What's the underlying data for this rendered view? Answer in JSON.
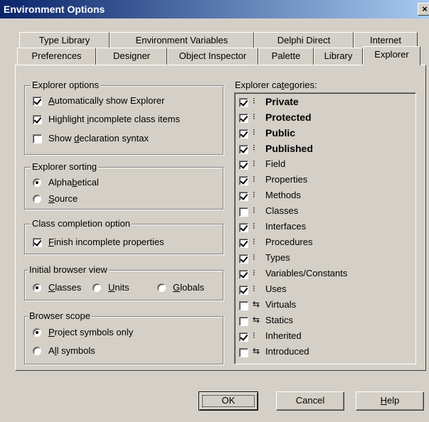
{
  "window": {
    "title": "Environment Options",
    "close_glyph": "×"
  },
  "tabs_row1": [
    {
      "label": "Type Library"
    },
    {
      "label": "Environment Variables"
    },
    {
      "label": "Delphi Direct"
    },
    {
      "label": "Internet"
    }
  ],
  "tabs_row2": [
    {
      "label": "Preferences"
    },
    {
      "label": "Designer"
    },
    {
      "label": "Object Inspector"
    },
    {
      "label": "Palette"
    },
    {
      "label": "Library"
    },
    {
      "label": "Explorer"
    }
  ],
  "active_tab": "Explorer",
  "explorer_options": {
    "legend": "Explorer options",
    "items": [
      {
        "pre": "",
        "acc": "A",
        "post": "utomatically show Explorer",
        "checked": true
      },
      {
        "pre": "Highlight ",
        "acc": "i",
        "post": "ncomplete class items",
        "checked": true
      },
      {
        "pre": "Show ",
        "acc": "d",
        "post": "eclaration syntax",
        "checked": false
      }
    ]
  },
  "explorer_sorting": {
    "legend": "Explorer sorting",
    "items": [
      {
        "pre": "Alpha",
        "acc": "b",
        "post": "etical",
        "checked": true
      },
      {
        "pre": "",
        "acc": "S",
        "post": "ource",
        "checked": false
      }
    ]
  },
  "class_completion": {
    "legend": "Class completion option",
    "items": [
      {
        "pre": "",
        "acc": "F",
        "post": "inish incomplete properties",
        "checked": true
      }
    ]
  },
  "initial_view": {
    "legend": "Initial browser view",
    "items": [
      {
        "pre": "",
        "acc": "C",
        "post": "lasses",
        "checked": true
      },
      {
        "pre": "",
        "acc": "U",
        "post": "nits",
        "checked": false
      },
      {
        "pre": "",
        "acc": "G",
        "post": "lobals",
        "checked": false
      }
    ]
  },
  "browser_scope": {
    "legend": "Browser scope",
    "items": [
      {
        "pre": "",
        "acc": "P",
        "post": "roject symbols only",
        "checked": true
      },
      {
        "pre": "A",
        "acc": "l",
        "post": "l symbols",
        "checked": false
      }
    ]
  },
  "categories": {
    "label_pre": "Explorer ca",
    "label_acc": "t",
    "label_post": "egories:",
    "items": [
      {
        "label": "Private",
        "checked": true,
        "bold": true,
        "icon": "⁝"
      },
      {
        "label": "Protected",
        "checked": true,
        "bold": true,
        "icon": "⁝"
      },
      {
        "label": "Public",
        "checked": true,
        "bold": true,
        "icon": "⁝"
      },
      {
        "label": "Published",
        "checked": true,
        "bold": true,
        "icon": "⁝"
      },
      {
        "label": "Field",
        "checked": true,
        "bold": false,
        "icon": "⁝"
      },
      {
        "label": "Properties",
        "checked": true,
        "bold": false,
        "icon": "⁝"
      },
      {
        "label": "Methods",
        "checked": true,
        "bold": false,
        "icon": "⁝"
      },
      {
        "label": "Classes",
        "checked": false,
        "bold": false,
        "icon": "⁝"
      },
      {
        "label": "Interfaces",
        "checked": true,
        "bold": false,
        "icon": "⁝"
      },
      {
        "label": "Procedures",
        "checked": true,
        "bold": false,
        "icon": "⁝"
      },
      {
        "label": "Types",
        "checked": true,
        "bold": false,
        "icon": "⁝"
      },
      {
        "label": "Variables/Constants",
        "checked": true,
        "bold": false,
        "icon": "⁝"
      },
      {
        "label": "Uses",
        "checked": true,
        "bold": false,
        "icon": "⁝"
      },
      {
        "label": "Virtuals",
        "checked": false,
        "bold": false,
        "icon": "⇆"
      },
      {
        "label": "Statics",
        "checked": false,
        "bold": false,
        "icon": "⇆"
      },
      {
        "label": "Inherited",
        "checked": true,
        "bold": false,
        "icon": "⁝"
      },
      {
        "label": "Introduced",
        "checked": false,
        "bold": false,
        "icon": "⇆"
      }
    ]
  },
  "buttons": {
    "ok": "OK",
    "cancel": "Cancel",
    "help_acc": "H",
    "help_post": "elp"
  }
}
